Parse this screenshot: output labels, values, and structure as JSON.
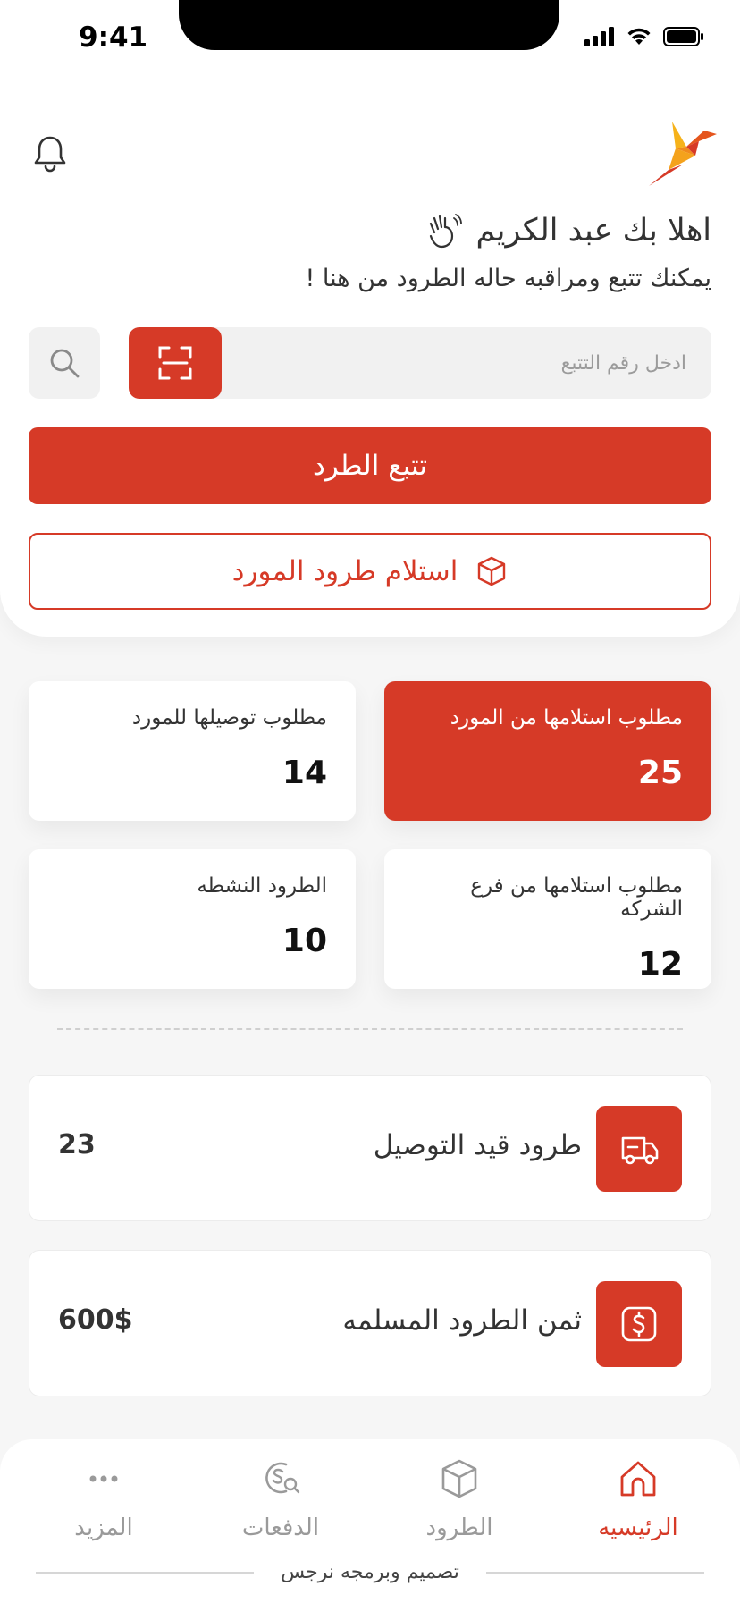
{
  "status_bar": {
    "time": "9:41"
  },
  "header": {
    "greeting": "اهلا بك عبد الكريم",
    "subtitle": "يمكنك تتبع ومراقبه حاله الطرود من هنا !",
    "icons": {
      "bell": "bell-icon",
      "logo": "bird-logo",
      "wave": "waving-hand-icon"
    }
  },
  "search": {
    "placeholder": "ادخل رقم التتبع"
  },
  "actions": {
    "track_label": "تتبع الطرد",
    "receive_label": "استلام طرود المورد"
  },
  "stats": [
    {
      "label": "مطلوب استلامها من المورد",
      "value": "25"
    },
    {
      "label": "مطلوب توصيلها للمورد",
      "value": "14"
    },
    {
      "label": "مطلوب استلامها من فرع الشركه",
      "value": "12"
    },
    {
      "label": "الطرود النشطه",
      "value": "10"
    }
  ],
  "summary": [
    {
      "label": "طرود قيد التوصيل",
      "value": "23",
      "icon": "delivery-truck-icon"
    },
    {
      "label": "ثمن الطرود المسلمه",
      "value": "600$",
      "icon": "dollar-icon"
    }
  ],
  "nav": [
    {
      "label": "الرئيسيه",
      "icon": "home-icon",
      "active": true
    },
    {
      "label": "الطرود",
      "icon": "box-icon",
      "active": false
    },
    {
      "label": "الدفعات",
      "icon": "payments-icon",
      "active": false
    },
    {
      "label": "المزيد",
      "icon": "more-icon",
      "active": false
    }
  ],
  "footer": {
    "credit": "تصميم وبرمجه نرجس"
  },
  "colors": {
    "accent": "#d63a27",
    "background": "#f6f6f6"
  }
}
